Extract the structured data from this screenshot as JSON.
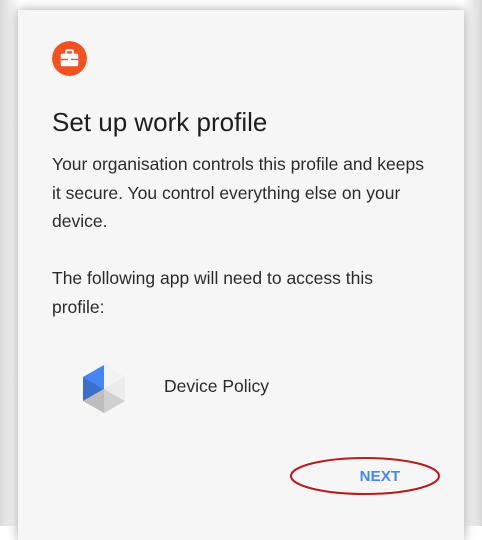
{
  "dialog": {
    "badge_icon": "briefcase-icon",
    "title": "Set up work profile",
    "description": "Your organisation controls this profile and keeps it secure. You control everything else on your device.",
    "access_text": "The following app will need to access this profile:",
    "app": {
      "icon": "device-policy-icon",
      "name": "Device Policy"
    },
    "next_label": "NEXT"
  },
  "colors": {
    "badge": "#f4511e",
    "accent": "#4285f4",
    "highlight_ring": "#b71c1c",
    "card_background": "#f6f6f6"
  }
}
